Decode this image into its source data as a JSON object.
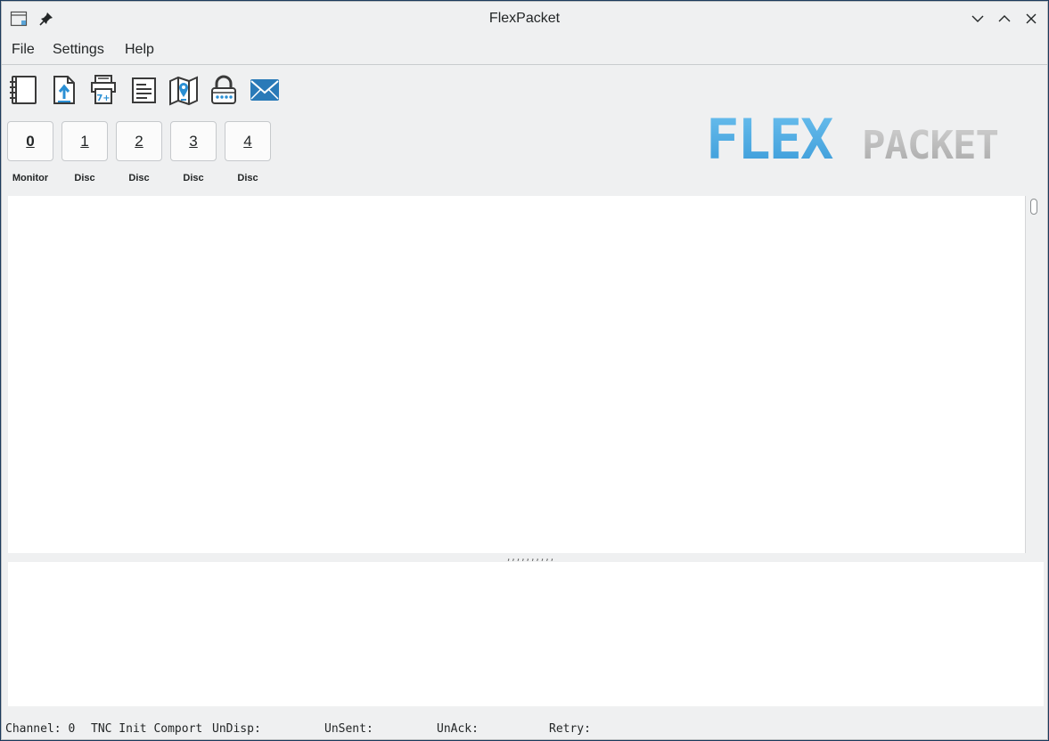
{
  "window": {
    "title": "FlexPacket"
  },
  "menubar": {
    "items": [
      "File",
      "Settings",
      "Help"
    ]
  },
  "toolbar": {
    "icons": [
      "notebook-icon",
      "upload-file-icon",
      "printer-icon",
      "document-icon",
      "map-pin-icon",
      "password-lock-icon",
      "mail-icon"
    ]
  },
  "channels": {
    "buttons": [
      "0",
      "1",
      "2",
      "3",
      "4"
    ],
    "labels": [
      "Monitor",
      "Disc",
      "Disc",
      "Disc",
      "Disc"
    ]
  },
  "logo": {
    "part1": "FLEX",
    "part2": "PACKET",
    "color1": "#4aa8e0",
    "color2": "#b4b4b4"
  },
  "splitter": {
    "grip": ",,,,,,,,,,"
  },
  "status": {
    "channel": "Channel: 0",
    "tnc": "TNC Init Comport",
    "undisp": "UnDisp:",
    "unsent": "UnSent:",
    "unack": "UnAck:",
    "retry": "Retry:"
  },
  "colors": {
    "accent": "#1d99f3",
    "icon_blue": "#2a7ab8",
    "icon_dark": "#4d4d4d"
  }
}
